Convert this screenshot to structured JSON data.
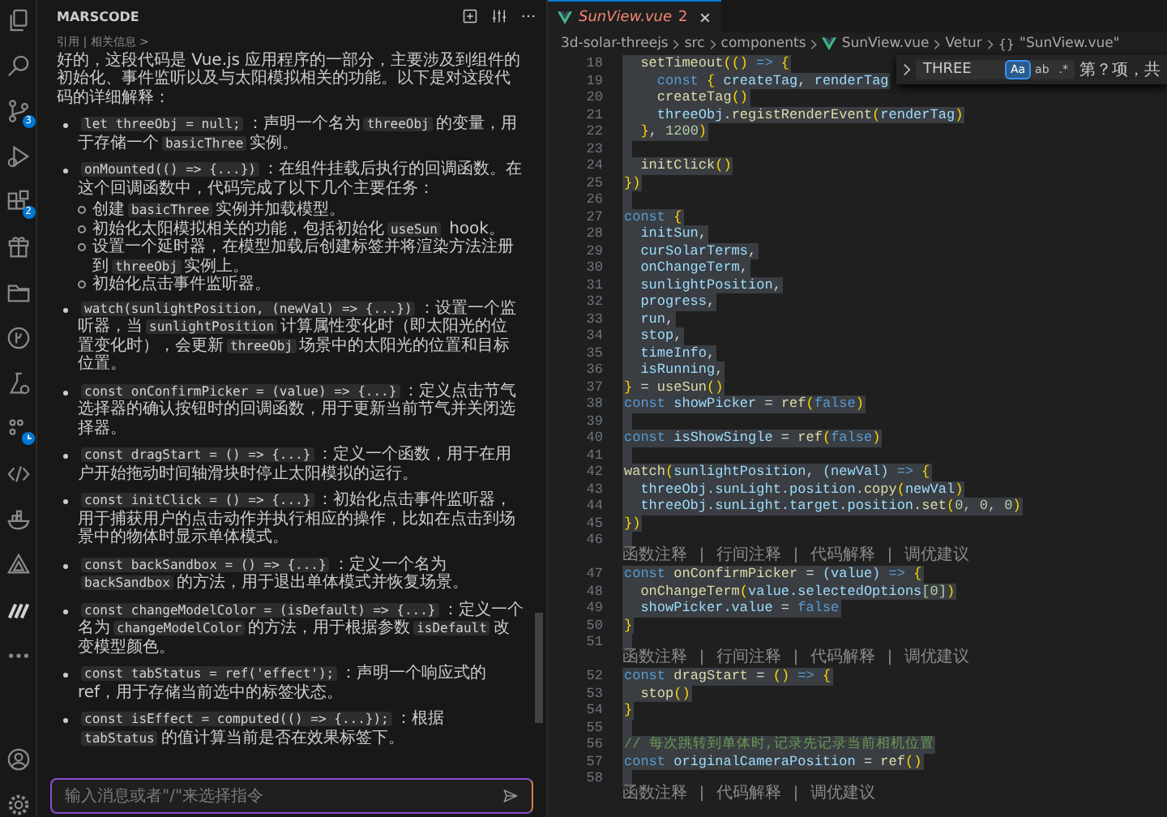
{
  "activity_bar": {
    "items": [
      {
        "kind": "files"
      },
      {
        "kind": "search"
      },
      {
        "kind": "source-control",
        "badge": "3"
      },
      {
        "kind": "run-debug"
      },
      {
        "kind": "extensions",
        "badge": "2"
      },
      {
        "kind": "box"
      },
      {
        "kind": "folder"
      },
      {
        "kind": "branch-circle"
      },
      {
        "kind": "flask"
      },
      {
        "kind": "timeline",
        "clock_badge": true
      },
      {
        "kind": "code"
      },
      {
        "kind": "ship"
      },
      {
        "kind": "triangle"
      },
      {
        "kind": "stripes"
      },
      {
        "kind": "more"
      }
    ],
    "bottom": [
      {
        "kind": "account"
      },
      {
        "kind": "settings"
      }
    ]
  },
  "chat": {
    "title": "MARSCODE",
    "breadcrumb": "引用 | 相关信息 >",
    "intro": "好的，这段代码是 Vue.js 应用程序的一部分，主要涉及到组件的初始化、事件监听以及与太阳模拟相关的功能。以下是对这段代码的详细解释：",
    "bullets": [
      {
        "parts": [
          {
            "kind": "code",
            "t": "let threeObj = null;"
          },
          {
            "kind": "text",
            "t": "：声明一个名为"
          },
          {
            "kind": "code",
            "t": "threeObj"
          },
          {
            "kind": "text",
            "t": "的变量，用于存储一个"
          },
          {
            "kind": "code",
            "t": "basicThree"
          },
          {
            "kind": "text",
            "t": "实例。"
          }
        ]
      },
      {
        "parts": [
          {
            "kind": "code",
            "t": "onMounted(() => {...})"
          },
          {
            "kind": "text",
            "t": "：在组件挂载后执行的回调函数。在这个回调函数中，代码完成了以下几个主要任务："
          }
        ],
        "children": [
          {
            "parts": [
              {
                "kind": "text",
                "t": "创建"
              },
              {
                "kind": "code",
                "t": "basicThree"
              },
              {
                "kind": "text",
                "t": "实例并加载模型。"
              }
            ]
          },
          {
            "parts": [
              {
                "kind": "text",
                "t": "初始化太阳模拟相关的功能，包括初始化"
              },
              {
                "kind": "code",
                "t": "useSun"
              },
              {
                "kind": "text",
                "t": " hook。"
              }
            ]
          },
          {
            "parts": [
              {
                "kind": "text",
                "t": "设置一个延时器，在模型加载后创建标签并将渲染方法注册到"
              },
              {
                "kind": "code",
                "t": "threeObj"
              },
              {
                "kind": "text",
                "t": "实例上。"
              }
            ]
          },
          {
            "parts": [
              {
                "kind": "text",
                "t": "初始化点击事件监听器。"
              }
            ]
          }
        ]
      },
      {
        "parts": [
          {
            "kind": "code",
            "t": "watch(sunlightPosition, (newVal) => {...})"
          },
          {
            "kind": "text",
            "t": "：设置一个监听器，当"
          },
          {
            "kind": "code",
            "t": "sunlightPosition"
          },
          {
            "kind": "text",
            "t": "计算属性变化时（即太阳光的位置变化时），会更新"
          },
          {
            "kind": "code",
            "t": "threeObj"
          },
          {
            "kind": "text",
            "t": "场景中的太阳光的位置和目标位置。"
          }
        ]
      },
      {
        "parts": [
          {
            "kind": "code",
            "t": "const onConfirmPicker = (value) => {...}"
          },
          {
            "kind": "text",
            "t": "：定义点击节气选择器的确认按钮时的回调函数，用于更新当前节气并关闭选择器。"
          }
        ]
      },
      {
        "parts": [
          {
            "kind": "code",
            "t": "const dragStart = () => {...}"
          },
          {
            "kind": "text",
            "t": "：定义一个函数，用于在用户开始拖动时间轴滑块时停止太阳模拟的运行。"
          }
        ]
      },
      {
        "parts": [
          {
            "kind": "code",
            "t": "const initClick = () => {...}"
          },
          {
            "kind": "text",
            "t": "：初始化点击事件监听器，用于捕获用户的点击动作并执行相应的操作，比如在点击到场景中的物体时显示单体模式。"
          }
        ]
      },
      {
        "parts": [
          {
            "kind": "code",
            "t": "const backSandbox = () => {...}"
          },
          {
            "kind": "text",
            "t": "：定义一个名为"
          },
          {
            "kind": "code",
            "t": "backSandbox"
          },
          {
            "kind": "text",
            "t": "的方法，用于退出单体模式并恢复场景。"
          }
        ]
      },
      {
        "parts": [
          {
            "kind": "code",
            "t": "const changeModelColor = (isDefault) => {...}"
          },
          {
            "kind": "text",
            "t": "：定义一个名为"
          },
          {
            "kind": "code",
            "t": "changeModelColor"
          },
          {
            "kind": "text",
            "t": "的方法，用于根据参数"
          },
          {
            "kind": "code",
            "t": "isDefault"
          },
          {
            "kind": "text",
            "t": "改变模型颜色。"
          }
        ]
      },
      {
        "parts": [
          {
            "kind": "code",
            "t": "const tabStatus = ref('effect');"
          },
          {
            "kind": "text",
            "t": "：声明一个响应式的ref，用于存储当前选中的标签状态。"
          }
        ]
      },
      {
        "parts": [
          {
            "kind": "code",
            "t": "const isEffect = computed(() => {...});"
          },
          {
            "kind": "text",
            "t": "：根据"
          },
          {
            "kind": "code",
            "t": "tabStatus"
          },
          {
            "kind": "text",
            "t": "的值计算当前是否在效果标签下。"
          }
        ]
      }
    ],
    "input": {
      "placeholder": "输入消息或者\"/\"来选择指令"
    }
  },
  "editor": {
    "tab": {
      "title": "SunView.vue",
      "problems": "2",
      "preview": true,
      "has_errors": true
    },
    "breadcrumb": [
      {
        "kind": "folder",
        "label": "3d-solar-threejs"
      },
      {
        "kind": "folder",
        "label": "src"
      },
      {
        "kind": "folder",
        "label": "components"
      },
      {
        "kind": "file",
        "label": "SunView.vue"
      },
      {
        "kind": "folder",
        "label": "Vetur"
      },
      {
        "kind": "symbol",
        "glyph": "{}",
        "label": "\"SunView.vue\""
      }
    ],
    "find": {
      "query": "THREE",
      "options": [
        {
          "label": "Aa",
          "selected": true
        },
        {
          "label": "ab",
          "selected": false
        },
        {
          "label": ".*",
          "selected": false
        }
      ],
      "result": "第？项，共"
    },
    "lines": [
      {
        "kind": "code",
        "n": "18",
        "selected": true,
        "tokens": [
          {
            "t": "  setTimeout",
            "kind": "fn"
          },
          {
            "t": "(() ",
            "kind": "br"
          },
          {
            "t": "=>",
            "kind": "kw"
          },
          {
            "t": " {",
            "kind": "br"
          }
        ]
      },
      {
        "kind": "code",
        "n": "19",
        "selected": true,
        "tokens": [
          {
            "t": "    const",
            "kind": "kw"
          },
          {
            "t": " { ",
            "kind": "br"
          },
          {
            "t": "createTag",
            "kind": "var"
          },
          {
            "t": ", ",
            "kind": "p"
          },
          {
            "t": "renderTag",
            "kind": "var"
          }
        ]
      },
      {
        "kind": "code",
        "n": "20",
        "selected": true,
        "tokens": [
          {
            "t": "    createTag",
            "kind": "fn"
          },
          {
            "t": "()",
            "kind": "br"
          }
        ]
      },
      {
        "kind": "code",
        "n": "21",
        "selected": true,
        "tokens": [
          {
            "t": "    threeObj",
            "kind": "var"
          },
          {
            "t": ".",
            "kind": "p"
          },
          {
            "t": "registRenderEvent",
            "kind": "fn"
          },
          {
            "t": "(",
            "kind": "br"
          },
          {
            "t": "renderTag",
            "kind": "var"
          },
          {
            "t": ")",
            "kind": "br"
          }
        ]
      },
      {
        "kind": "code",
        "n": "22",
        "selected": true,
        "tokens": [
          {
            "t": "  }",
            "kind": "br"
          },
          {
            "t": ", ",
            "kind": "p"
          },
          {
            "t": "1200",
            "kind": "num"
          },
          {
            "t": ")",
            "kind": "br"
          }
        ]
      },
      {
        "kind": "code",
        "n": "23",
        "selected": true
      },
      {
        "kind": "code",
        "n": "24",
        "selected": true,
        "tokens": [
          {
            "t": "  initClick",
            "kind": "fn"
          },
          {
            "t": "()",
            "kind": "br"
          }
        ]
      },
      {
        "kind": "code",
        "n": "25",
        "selected": true,
        "tokens": [
          {
            "t": "})",
            "kind": "br"
          }
        ]
      },
      {
        "kind": "code",
        "n": "26",
        "selected": true
      },
      {
        "kind": "code",
        "n": "27",
        "selected": true,
        "tokens": [
          {
            "t": "const",
            "kind": "kw"
          },
          {
            "t": " {",
            "kind": "br"
          }
        ]
      },
      {
        "kind": "code",
        "n": "28",
        "selected": true,
        "tokens": [
          {
            "t": "  initSun",
            "kind": "var"
          },
          {
            "t": ",",
            "kind": "p"
          }
        ]
      },
      {
        "kind": "code",
        "n": "29",
        "selected": true,
        "tokens": [
          {
            "t": "  curSolarTerms",
            "kind": "var"
          },
          {
            "t": ",",
            "kind": "p"
          }
        ]
      },
      {
        "kind": "code",
        "n": "30",
        "selected": true,
        "tokens": [
          {
            "t": "  onChangeTerm",
            "kind": "var"
          },
          {
            "t": ",",
            "kind": "p"
          }
        ]
      },
      {
        "kind": "code",
        "n": "31",
        "selected": true,
        "tokens": [
          {
            "t": "  sunlightPosition",
            "kind": "var"
          },
          {
            "t": ",",
            "kind": "p"
          }
        ]
      },
      {
        "kind": "code",
        "n": "32",
        "selected": true,
        "tokens": [
          {
            "t": "  progress",
            "kind": "var"
          },
          {
            "t": ",",
            "kind": "p"
          }
        ]
      },
      {
        "kind": "code",
        "n": "33",
        "selected": true,
        "tokens": [
          {
            "t": "  run",
            "kind": "var"
          },
          {
            "t": ",",
            "kind": "p"
          }
        ]
      },
      {
        "kind": "code",
        "n": "34",
        "selected": true,
        "tokens": [
          {
            "t": "  stop",
            "kind": "var"
          },
          {
            "t": ",",
            "kind": "p"
          }
        ]
      },
      {
        "kind": "code",
        "n": "35",
        "selected": true,
        "tokens": [
          {
            "t": "  timeInfo",
            "kind": "var"
          },
          {
            "t": ",",
            "kind": "p"
          }
        ]
      },
      {
        "kind": "code",
        "n": "36",
        "selected": true,
        "tokens": [
          {
            "t": "  isRunning",
            "kind": "var"
          },
          {
            "t": ",",
            "kind": "p"
          }
        ]
      },
      {
        "kind": "code",
        "n": "37",
        "selected": true,
        "tokens": [
          {
            "t": "}",
            "kind": "br"
          },
          {
            "t": " = ",
            "kind": "p"
          },
          {
            "t": "useSun",
            "kind": "fn"
          },
          {
            "t": "()",
            "kind": "br"
          }
        ]
      },
      {
        "kind": "code",
        "n": "38",
        "selected": true,
        "tokens": [
          {
            "t": "const",
            "kind": "kw"
          },
          {
            "t": " showPicker",
            "kind": "var"
          },
          {
            "t": " = ",
            "kind": "p"
          },
          {
            "t": "ref",
            "kind": "fn"
          },
          {
            "t": "(",
            "kind": "br"
          },
          {
            "t": "false",
            "kind": "kw"
          },
          {
            "t": ")",
            "kind": "br"
          }
        ]
      },
      {
        "kind": "code",
        "n": "39",
        "selected": true
      },
      {
        "kind": "code",
        "n": "40",
        "selected": true,
        "tokens": [
          {
            "t": "const",
            "kind": "kw"
          },
          {
            "t": " isShowSingle",
            "kind": "var"
          },
          {
            "t": " = ",
            "kind": "p"
          },
          {
            "t": "ref",
            "kind": "fn"
          },
          {
            "t": "(",
            "kind": "br"
          },
          {
            "t": "false",
            "kind": "kw"
          },
          {
            "t": ")",
            "kind": "br"
          }
        ]
      },
      {
        "kind": "code",
        "n": "41",
        "selected": true
      },
      {
        "kind": "code",
        "n": "42",
        "selected": true,
        "tokens": [
          {
            "t": "watch",
            "kind": "fn"
          },
          {
            "t": "(",
            "kind": "br"
          },
          {
            "t": "sunlightPosition",
            "kind": "var"
          },
          {
            "t": ", ",
            "kind": "p"
          },
          {
            "t": "(newVal)",
            "kind": "var"
          },
          {
            "t": " => ",
            "kind": "kw"
          },
          {
            "t": "{",
            "kind": "br"
          }
        ]
      },
      {
        "kind": "code",
        "n": "43",
        "selected": true,
        "tokens": [
          {
            "t": "  threeObj.sunLight.position",
            "kind": "var"
          },
          {
            "t": ".",
            "kind": "p"
          },
          {
            "t": "copy",
            "kind": "fn"
          },
          {
            "t": "(",
            "kind": "br"
          },
          {
            "t": "newVal",
            "kind": "var"
          },
          {
            "t": ")",
            "kind": "br"
          }
        ]
      },
      {
        "kind": "code",
        "n": "44",
        "selected": true,
        "tokens": [
          {
            "t": "  threeObj.sunLight.target.position",
            "kind": "var"
          },
          {
            "t": ".",
            "kind": "p"
          },
          {
            "t": "set",
            "kind": "fn"
          },
          {
            "t": "(",
            "kind": "br"
          },
          {
            "t": "0, 0, 0",
            "kind": "num"
          },
          {
            "t": ")",
            "kind": "br"
          }
        ]
      },
      {
        "kind": "code",
        "n": "45",
        "selected": true,
        "tokens": [
          {
            "t": "})",
            "kind": "br"
          }
        ]
      },
      {
        "kind": "code",
        "n": "46",
        "selected": true
      },
      {
        "kind": "lens",
        "text": "函数注释 | 行间注释 | 代码解释 | 调优建议"
      },
      {
        "kind": "code",
        "n": "47",
        "selected": true,
        "tokens": [
          {
            "t": "const",
            "kind": "kw"
          },
          {
            "t": " onConfirmPicker",
            "kind": "fn"
          },
          {
            "t": " = ",
            "kind": "p"
          },
          {
            "t": "(value)",
            "kind": "var"
          },
          {
            "t": " => ",
            "kind": "kw"
          },
          {
            "t": "{",
            "kind": "br"
          }
        ]
      },
      {
        "kind": "code",
        "n": "48",
        "selected": true,
        "tokens": [
          {
            "t": "  onChangeTerm",
            "kind": "fn"
          },
          {
            "t": "(",
            "kind": "br"
          },
          {
            "t": "value.selectedOptions",
            "kind": "var"
          },
          {
            "t": "[0]",
            "kind": "num"
          },
          {
            "t": ")",
            "kind": "br"
          }
        ]
      },
      {
        "kind": "code",
        "n": "49",
        "selected": true,
        "tokens": [
          {
            "t": "  showPicker.value",
            "kind": "var"
          },
          {
            "t": " = ",
            "kind": "p"
          },
          {
            "t": "false",
            "kind": "kw"
          }
        ]
      },
      {
        "kind": "code",
        "n": "50",
        "selected": true,
        "tokens": [
          {
            "t": "}",
            "kind": "br"
          }
        ]
      },
      {
        "kind": "code",
        "n": "51",
        "selected": true
      },
      {
        "kind": "lens",
        "text": "函数注释 | 行间注释 | 代码解释 | 调优建议"
      },
      {
        "kind": "code",
        "n": "52",
        "selected": true,
        "tokens": [
          {
            "t": "const",
            "kind": "kw"
          },
          {
            "t": " dragStart",
            "kind": "fn"
          },
          {
            "t": " = ",
            "kind": "p"
          },
          {
            "t": "()",
            "kind": "br"
          },
          {
            "t": " => ",
            "kind": "kw"
          },
          {
            "t": "{",
            "kind": "br"
          }
        ]
      },
      {
        "kind": "code",
        "n": "53",
        "selected": true,
        "tokens": [
          {
            "t": "  stop",
            "kind": "fn"
          },
          {
            "t": "()",
            "kind": "br"
          }
        ]
      },
      {
        "kind": "code",
        "n": "54",
        "selected": true,
        "tokens": [
          {
            "t": "}",
            "kind": "br"
          }
        ]
      },
      {
        "kind": "code",
        "n": "55",
        "selected": true
      },
      {
        "kind": "code",
        "n": "56",
        "selected": true,
        "tokens": [
          {
            "t": "// 每次跳转到单体时,记录先记录当前相机位置",
            "kind": "cm"
          }
        ]
      },
      {
        "kind": "code",
        "n": "57",
        "selected": true,
        "tokens": [
          {
            "t": "const",
            "kind": "kw"
          },
          {
            "t": " originalCameraPosition",
            "kind": "var"
          },
          {
            "t": " = ",
            "kind": "p"
          },
          {
            "t": "ref",
            "kind": "fn"
          },
          {
            "t": "()",
            "kind": "br"
          }
        ]
      },
      {
        "kind": "code",
        "n": "58",
        "selected": true
      },
      {
        "kind": "lens",
        "text": "函数注释 | 代码解释 | 调优建议"
      }
    ]
  }
}
